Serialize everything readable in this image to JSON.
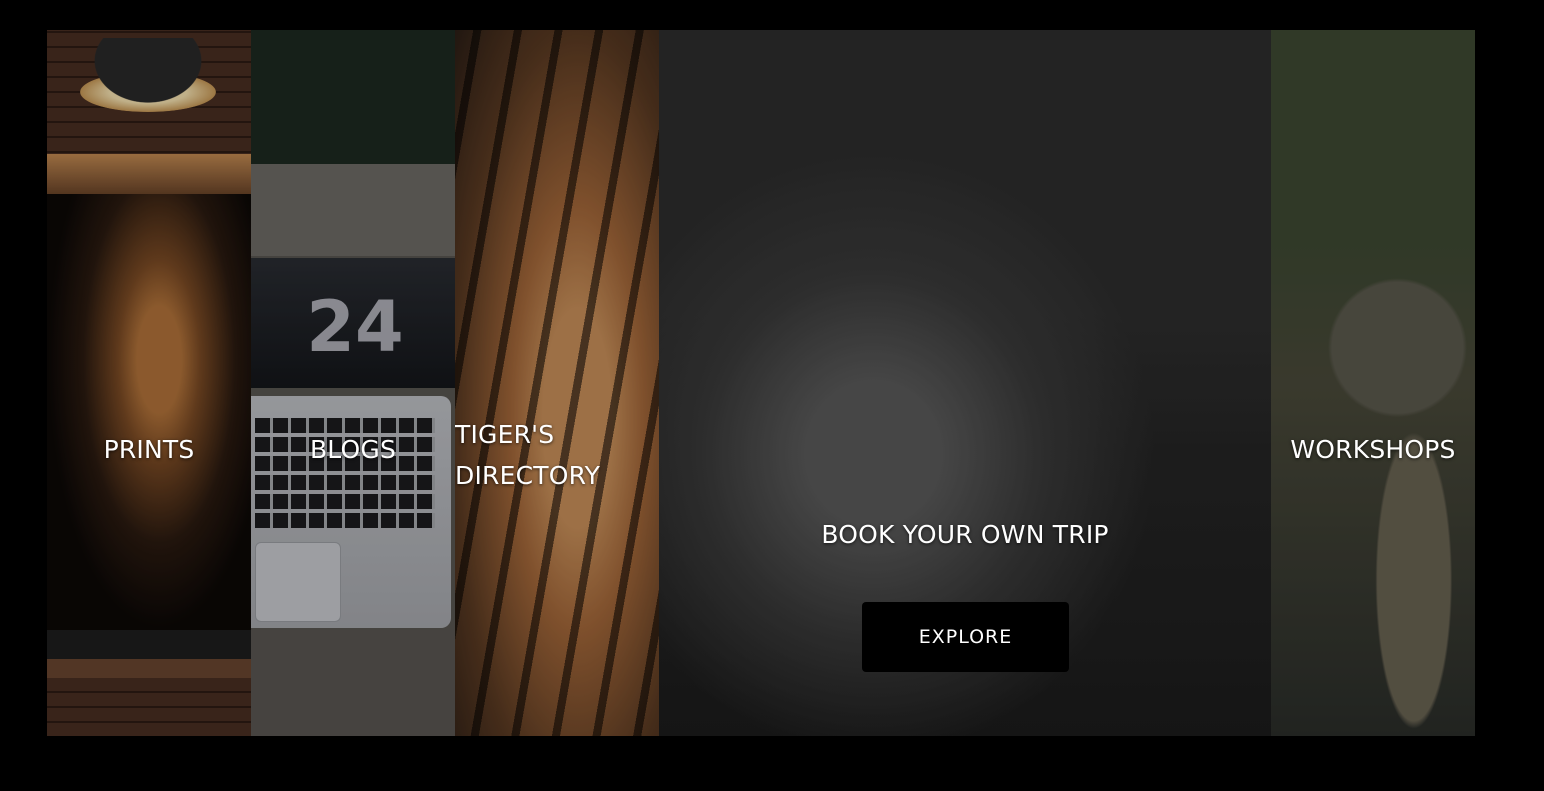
{
  "panels": [
    {
      "id": "prints",
      "label": "PRINTS"
    },
    {
      "id": "blogs",
      "label": "BLOGS",
      "laptop_display": "24"
    },
    {
      "id": "directory",
      "label": "TIGER'S DIRECTORY"
    },
    {
      "id": "book",
      "label": "BOOK YOUR OWN TRIP",
      "button": "EXPLORE"
    },
    {
      "id": "workshops",
      "label": "WORKSHOPS"
    }
  ],
  "colors": {
    "page_background": "#000000",
    "button_background": "#000000",
    "label_text": "#ffffff"
  }
}
